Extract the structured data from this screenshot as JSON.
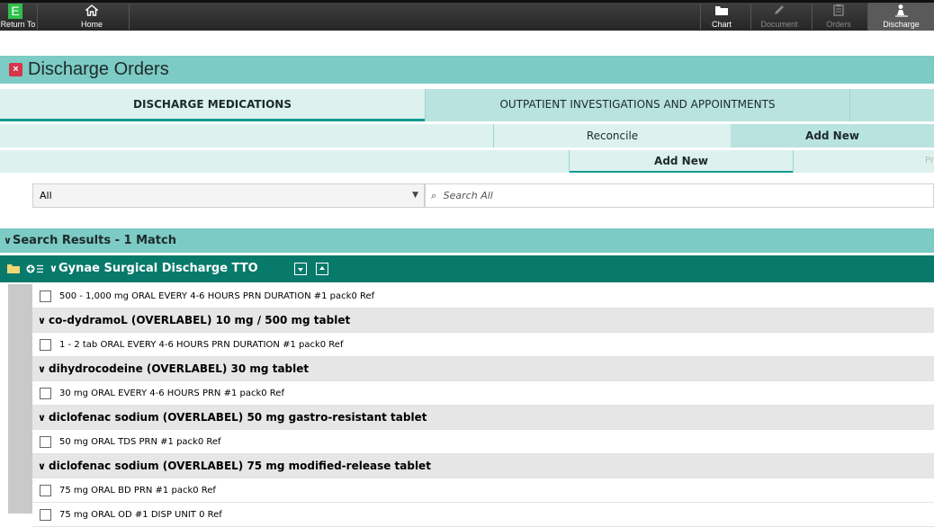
{
  "toolbar": {
    "return_to": "Return To",
    "home": "Home",
    "chart": "Chart",
    "document": "Document",
    "orders": "Orders",
    "discharge": "Discharge"
  },
  "page": {
    "title": "Discharge Orders"
  },
  "tabs": {
    "primary": [
      "DISCHARGE MEDICATIONS",
      "OUTPATIENT INVESTIGATIONS AND APPOINTMENTS"
    ],
    "secondary": [
      "Reconcile",
      "Add New"
    ],
    "tertiary": [
      "Add New",
      "Pr"
    ]
  },
  "filter": {
    "selected": "All"
  },
  "search": {
    "placeholder": "Search All"
  },
  "results": {
    "header": "Search Results - 1 Match",
    "folder": "Gynae Surgical Discharge TTO",
    "rows": [
      {
        "type": "detail",
        "text": "500 - 1,000 mg ORAL EVERY 4-6 HOURS PRN DURATION #1 pack0 Ref"
      },
      {
        "type": "group",
        "text": "co-dydramoL (OVERLABEL) 10 mg / 500 mg tablet"
      },
      {
        "type": "detail",
        "text": "1 - 2 tab ORAL EVERY 4-6 HOURS PRN DURATION #1 pack0 Ref"
      },
      {
        "type": "group",
        "text": "dihydrocodeine (OVERLABEL) 30 mg tablet"
      },
      {
        "type": "detail",
        "text": "30 mg ORAL EVERY 4-6 HOURS PRN #1 pack0 Ref"
      },
      {
        "type": "group",
        "text": "diclofenac sodium (OVERLABEL) 50 mg gastro-resistant tablet"
      },
      {
        "type": "detail",
        "text": "50 mg ORAL TDS PRN #1 pack0 Ref"
      },
      {
        "type": "group",
        "text": "diclofenac sodium (OVERLABEL) 75 mg modified-release tablet"
      },
      {
        "type": "detail",
        "text": "75 mg ORAL BD PRN #1 pack0 Ref"
      },
      {
        "type": "detail",
        "text": "75 mg ORAL OD #1 DISP UNIT 0 Ref"
      }
    ]
  },
  "icons": {
    "app_logo": "E",
    "close": "×",
    "chevron": "∨",
    "dropdown": "▼",
    "search": "⌕"
  },
  "colors": {
    "accent_teal": "#7ccbc4",
    "folder_green": "#087a6b",
    "close_red": "#d6344a",
    "logo_green": "#2fbf4a"
  }
}
